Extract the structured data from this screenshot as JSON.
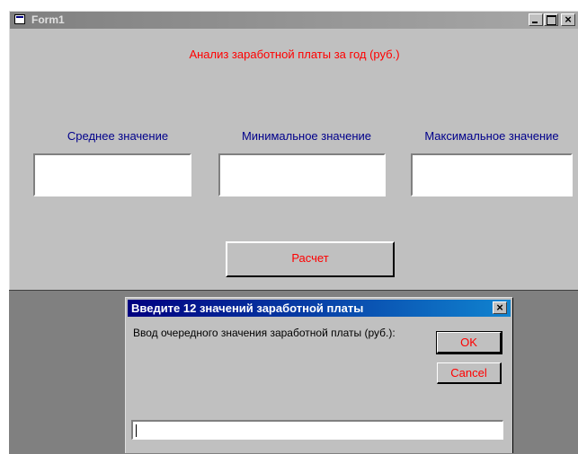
{
  "form": {
    "title": "Form1",
    "heading": "Анализ заработной платы за год (руб.)",
    "labels": [
      "Среднее значение",
      "Минимальное значение",
      "Максимальное значение"
    ],
    "fields": [
      "",
      "",
      ""
    ],
    "calc_button": "Расчет"
  },
  "dialog": {
    "title": "Введите 12 значений заработной платы",
    "prompt": "Ввод очередного значения заработной платы (руб.):",
    "ok": "OK",
    "cancel": "Cancel",
    "input_value": ""
  },
  "colors": {
    "form_bg": "#c0c0c0",
    "label_text": "#00008b",
    "accent_text": "#ff0000",
    "dialog_titlebar": "#000080"
  },
  "icons": [
    "app-icon",
    "minimize-icon",
    "maximize-icon",
    "close-icon"
  ]
}
